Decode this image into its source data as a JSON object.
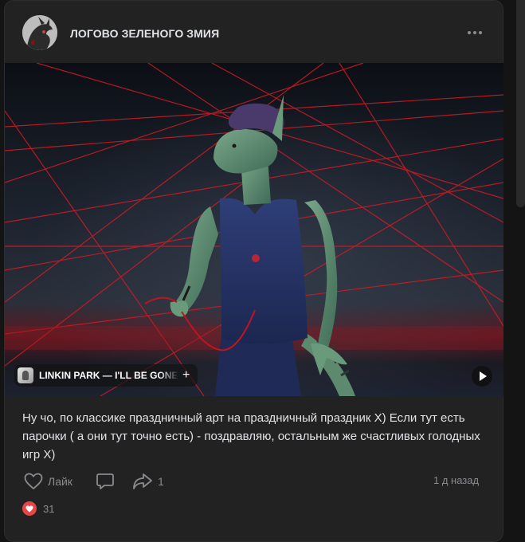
{
  "post": {
    "community_name": "ЛОГОВО ЗЕЛЕНОГО ЗМИЯ",
    "text": "Ну чо, по классике праздничный арт на праздничный праздник Х) Если тут есть парочки ( а они тут точно есть) - поздравляю, остальным же счастливых голодных игр Х)",
    "music": {
      "title": "LINKIN PARK — I'LL BE GONE",
      "add_symbol": "+"
    },
    "actions": {
      "like_label": "Лайк",
      "share_count": "1"
    },
    "time": "1 д назад",
    "reactions_count": "31"
  },
  "icons": {
    "more": "more-horizontal-icon",
    "like": "heart-outline-icon",
    "comment": "comment-icon",
    "share": "share-arrow-icon",
    "play": "play-icon",
    "reaction": "heart-filled-icon"
  },
  "colors": {
    "background": "#141414",
    "card": "#222222",
    "text": "#e1e3e6",
    "muted": "#8a8c90",
    "reaction_red": "#e64646",
    "laser_red": "#d41a24"
  }
}
